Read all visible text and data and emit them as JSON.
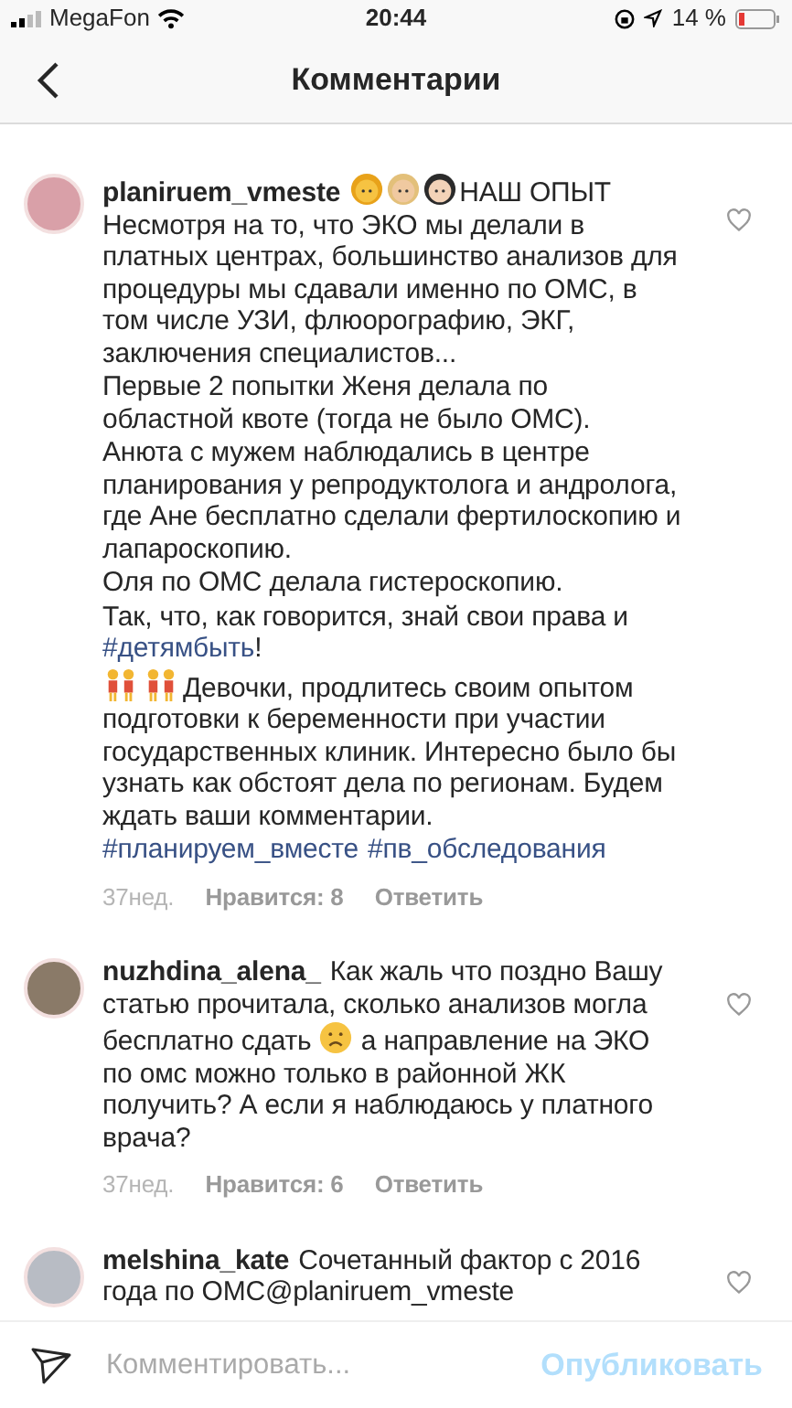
{
  "status_bar": {
    "carrier": "MegaFon",
    "time": "20:44",
    "battery": "14 %"
  },
  "header": {
    "title": "Комментарии"
  },
  "comments": [
    {
      "username": "planiruem_vmeste",
      "paragraphs": [
        [
          {
            "kind": "woman-emoji"
          },
          {
            "kind": "light-woman-emoji"
          },
          {
            "kind": "dark-hair-woman-emoji"
          },
          {
            "kind": "text",
            "text": "НАШ ОПЫТ Несмотря на то, что ЭКО мы делали в платных центрах, большинство анализов для процедуры мы сдавали именно по ОМС, в том числе УЗИ, флюорографию, ЭКГ, заключения специалистов..."
          }
        ],
        [
          {
            "kind": "text",
            "text": "Первые 2 попытки Женя делала по областной квоте (тогда не было ОМС)."
          }
        ],
        [
          {
            "kind": "text",
            "text": "Анюта с  мужем наблюдались в центре планирования у репродуктолога и андролога, где Ане бесплатно сделали фертилоскопию и лапароскопию."
          }
        ],
        [
          {
            "kind": "text",
            "text": "Оля по ОМС делала гистероскопию."
          }
        ],
        [
          {
            "kind": "text",
            "text": "Так, что, как говорится, знай свои права и "
          },
          {
            "kind": "hashtag",
            "text": "#детямбыть"
          },
          {
            "kind": "text",
            "text": "!"
          }
        ],
        [
          {
            "kind": "two-women-emoji"
          },
          {
            "kind": "two-women-emoji"
          },
          {
            "kind": "text",
            "text": "Девочки, продлитесь своим опытом подготовки к беременности при участии государственных клиник. Интересно было бы узнать как обстоят дела по регионам. Будем ждать ваши комментарии."
          }
        ],
        [
          {
            "kind": "hashtag",
            "text": "#планируем_вместе"
          },
          {
            "kind": "hashtag",
            "text": "#пв_обследования"
          }
        ]
      ],
      "time": "37нед.",
      "likes": "Нравится: 8",
      "reply": "Ответить"
    },
    {
      "username": "nuzhdina_alena_",
      "paragraphs": [
        [
          {
            "kind": "text",
            "text": "Как жаль что поздно Вашу статью прочитала, сколько анализов могла бесплатно сдать "
          },
          {
            "kind": "sad-emoji"
          },
          {
            "kind": "text",
            "text": " а направление на ЭКО по омс можно только в районной ЖК получить? А если  я наблюдаюсь у платного врача?"
          }
        ]
      ],
      "time": "37нед.",
      "likes": "Нравится: 6",
      "reply": "Ответить"
    },
    {
      "username": "melshina_kate",
      "paragraphs": [
        [
          {
            "kind": "text",
            "text": "Сочетанный фактор с 2016 года по ОМС@planiruem_vmeste"
          }
        ]
      ]
    }
  ],
  "composer": {
    "placeholder": "Комментировать...",
    "submit": "Опубликовать"
  }
}
